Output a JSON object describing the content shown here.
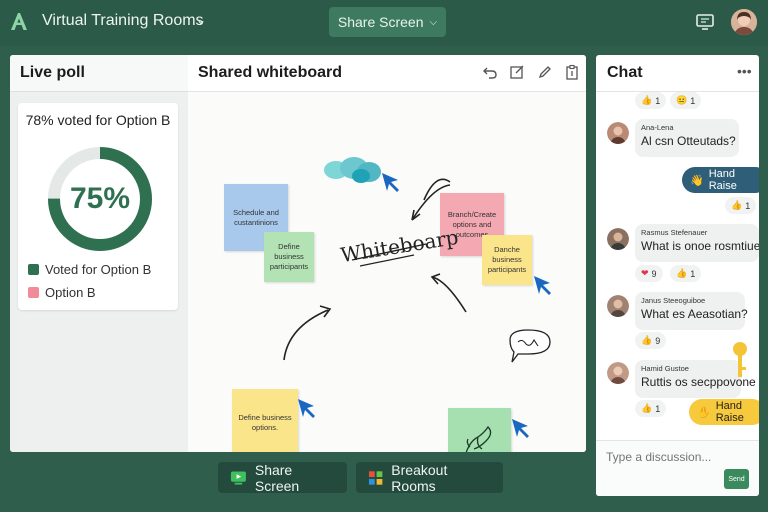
{
  "topbar": {
    "app_title": "Virtual Training Rooms",
    "share_label": "Share Screen"
  },
  "colors": {
    "brand": "#2b5a49",
    "accent": "#3d7a5f",
    "poll_primary": "#2f7050",
    "poll_secondary": "#f28a9a",
    "hand_raise_blue": "#2e5e78",
    "hand_raise_yellow": "#f7c93c"
  },
  "poll": {
    "panel_title": "Live poll",
    "question": "78% voted for Option B",
    "percent_label": "75%",
    "percent_value": 75,
    "legend": [
      {
        "label": "Voted for Option B",
        "color": "#2f7050"
      },
      {
        "label": "Option B",
        "color": "#f28a9a"
      }
    ]
  },
  "whiteboard": {
    "title": "Shared whiteboard",
    "tools": [
      "undo-icon",
      "edit-box-icon",
      "pen-icon",
      "clipboard-icon"
    ],
    "center_text": "Whiteboarp",
    "notes": [
      {
        "text": "Schedule and custantinions",
        "color": "#a9c9ec"
      },
      {
        "text": "Define business participants",
        "color": "#b3e3b5"
      },
      {
        "text": "Branch/Create options and outcomes",
        "color": "#f3a8b2"
      },
      {
        "text": "Danche business participants",
        "color": "#fbe58a"
      },
      {
        "text": "Define business options.",
        "color": "#fbe58a"
      },
      {
        "text": "",
        "color": "#a6e0b0"
      }
    ]
  },
  "bottom": {
    "share_label": "Share Screen",
    "breakout_label": "Breakout Rooms"
  },
  "chat": {
    "title": "Chat",
    "reactions_top": [
      {
        "emoji": "👍",
        "count": "1"
      },
      {
        "emoji": "😐",
        "count": "1"
      }
    ],
    "messages": [
      {
        "name": "Ana-Lena",
        "text": "Al csn Otteutads?"
      },
      {
        "name": "Rasmus Stefenauer",
        "text": "What is onoe rosmtiue?"
      },
      {
        "name": "Janus Steeoguiboe",
        "text": "What es Aeasotian?"
      },
      {
        "name": "Hamid Gustoe",
        "text": "Ruttis os secppovone"
      }
    ],
    "hand_raise_1": "Hand Raise",
    "hand_raise_2": "Hand Raise",
    "r_count_1": "1",
    "r_heart": "9",
    "r_thumb_2": "1",
    "r_thumb_3": "9",
    "r_thumb_4": "1",
    "input_placeholder": "Type a discussion...",
    "send_label": "Send"
  }
}
